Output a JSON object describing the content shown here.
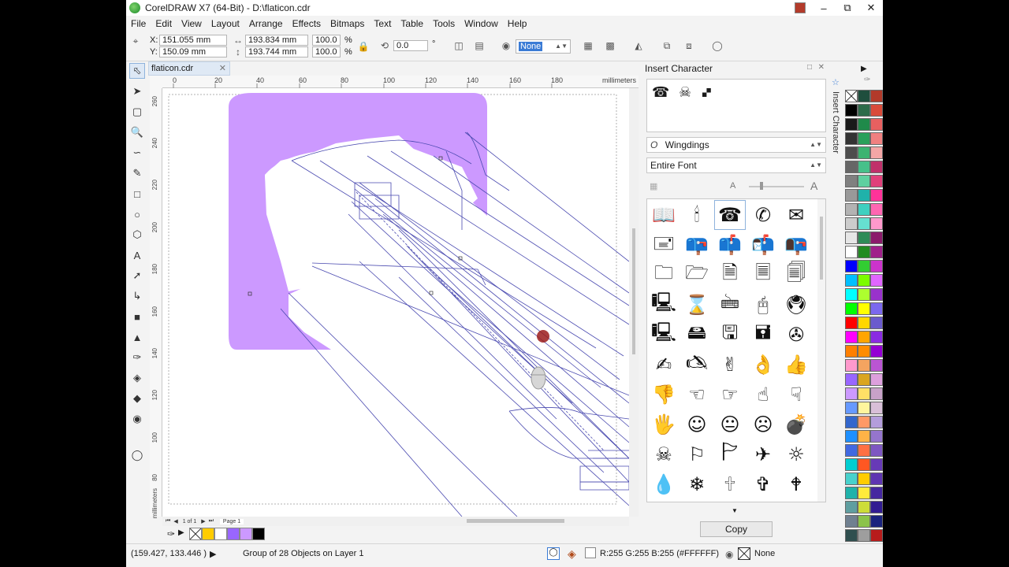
{
  "title": "CorelDRAW X7 (64-Bit) - D:\\flaticon.cdr",
  "menu": [
    "File",
    "Edit",
    "View",
    "Layout",
    "Arrange",
    "Effects",
    "Bitmaps",
    "Text",
    "Table",
    "Tools",
    "Window",
    "Help"
  ],
  "props": {
    "x_label": "X:",
    "x": "151.055 mm",
    "y_label": "Y:",
    "y": "150.09 mm",
    "w": "193.834 mm",
    "h": "193.744 mm",
    "sx": "100.0",
    "sy": "100.0",
    "pct": "%",
    "rotation": "0.0",
    "deg": "°",
    "outline": "None"
  },
  "doc_tab": "flaticon.cdr",
  "ruler": {
    "h_ticks": [
      "0",
      "20",
      "40",
      "60",
      "80",
      "100",
      "120",
      "140",
      "160",
      "180"
    ],
    "units": "millimeters",
    "v_ticks": [
      "260",
      "240",
      "220",
      "200",
      "180",
      "160",
      "140",
      "120",
      "100",
      "80"
    ],
    "v_units": "millimeters"
  },
  "page_nav": {
    "pos": "1 of 1",
    "page": "Page 1"
  },
  "docker": {
    "title": "Insert Character",
    "preview": [
      "☎",
      "☠",
      "🙾"
    ],
    "font": "Wingdings",
    "font_icon": "O",
    "subset": "Entire Font",
    "copy": "Copy",
    "tab": "Insert Character",
    "glyphs": [
      [
        "📖",
        "🕯",
        "☎",
        "✆",
        "✉"
      ],
      [
        "🖃",
        "📪",
        "📫",
        "📬",
        "📭"
      ],
      [
        "🗀",
        "🗁",
        "🗎",
        "🗏",
        "🗐"
      ],
      [
        "🖳",
        "⌛",
        "🖮",
        "🖰",
        "🖲"
      ],
      [
        "🖳",
        "🖴",
        "🖫",
        "🖬",
        "✇"
      ],
      [
        "✍",
        "🖎",
        "✌",
        "👌",
        "👍"
      ],
      [
        "👎",
        "☜",
        "☞",
        "☝",
        "☟"
      ],
      [
        "🖐",
        "☺",
        "😐",
        "☹",
        "💣"
      ],
      [
        "☠",
        "⚐",
        "🏱",
        "✈",
        "☼"
      ],
      [
        "💧",
        "❄",
        "🕆",
        "✞",
        "🕈"
      ]
    ]
  },
  "status": {
    "coords": "(159.427, 133.446 )",
    "play": "▶",
    "message": "Group of 28 Objects on Layer 1",
    "fill": "R:255 G:255 B:255 (#FFFFFF)",
    "outline": "None"
  },
  "colors": {
    "purple": "#cc99ff",
    "line": "#4a4ab0",
    "marker": "#9b1c1c"
  },
  "doc_palette": [
    "#ffcc00",
    "#ffffff",
    "#9966ff",
    "#cc99ff",
    "#000000"
  ]
}
